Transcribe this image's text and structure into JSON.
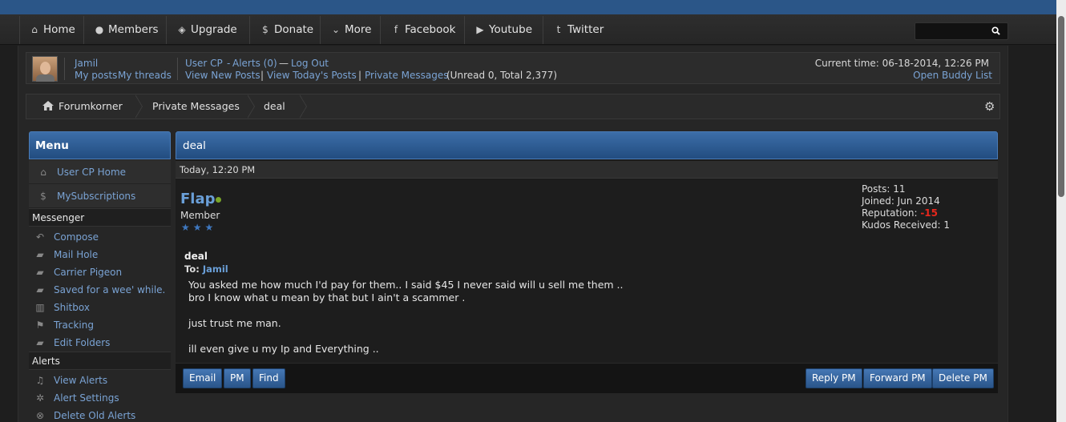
{
  "nav": {
    "items": [
      {
        "icon": "home-icon",
        "glyph": "⌂",
        "label": "Home"
      },
      {
        "icon": "members-icon",
        "glyph": "●",
        "label": "Members"
      },
      {
        "icon": "tag-icon",
        "glyph": "◈",
        "label": "Upgrade"
      },
      {
        "icon": "dollar-icon",
        "glyph": "$",
        "label": "Donate"
      },
      {
        "icon": "chevron-down-icon",
        "glyph": "⌄",
        "label": "More"
      },
      {
        "icon": "facebook-icon",
        "glyph": "f",
        "label": "Facebook"
      },
      {
        "icon": "play-icon",
        "glyph": "▶",
        "label": "Youtube"
      },
      {
        "icon": "twitter-icon",
        "glyph": "t",
        "label": "Twitter"
      }
    ],
    "search_placeholder": ""
  },
  "welcome": {
    "username": "Jamil",
    "my_posts": "My posts",
    "my_threads": "My threads",
    "user_cp": "User CP",
    "dash": "-",
    "alerts": "Alerts (0)",
    "emdash": "—",
    "log_out": "Log Out",
    "view_new_posts": "View New Posts",
    "pipe": "|",
    "view_todays_posts": "View Today's Posts",
    "private_messages": "Private Messages",
    "unread_total": "(Unread 0, Total 2,377)",
    "current_time": "Current time: 06-18-2014, 12:26 PM",
    "open_buddy_list": "Open Buddy List"
  },
  "breadcrumb": {
    "home": "Forumkorner",
    "section": "Private Messages",
    "current": "deal"
  },
  "sidebar": {
    "title": "Menu",
    "top_items": [
      {
        "icon": "home-icon",
        "glyph": "⌂",
        "label": "User CP Home"
      },
      {
        "icon": "dollar-icon",
        "glyph": "$",
        "label": "MySubscriptions"
      }
    ],
    "messenger_title": "Messenger",
    "messenger_items": [
      {
        "icon": "reply-icon",
        "glyph": "↶",
        "label": "Compose"
      },
      {
        "icon": "folder-open-icon",
        "glyph": "▰",
        "label": "Mail Hole"
      },
      {
        "icon": "folder-icon",
        "glyph": "▰",
        "label": "Carrier Pigeon"
      },
      {
        "icon": "folder-icon",
        "glyph": "▰",
        "label": "Saved for a wee' while."
      },
      {
        "icon": "trash-icon",
        "glyph": "▥",
        "label": "Shitbox"
      },
      {
        "icon": "flag-icon",
        "glyph": "⚑",
        "label": "Tracking"
      },
      {
        "icon": "folder-icon",
        "glyph": "▰",
        "label": "Edit Folders"
      }
    ],
    "alerts_title": "Alerts",
    "alerts_items": [
      {
        "icon": "bell-icon",
        "glyph": "♫",
        "label": "View Alerts"
      },
      {
        "icon": "cogs-icon",
        "glyph": "✲",
        "label": "Alert Settings"
      },
      {
        "icon": "delete-circle-icon",
        "glyph": "⊗",
        "label": "Delete Old Alerts"
      }
    ]
  },
  "message": {
    "header": "deal",
    "date": "Today, 12:20 PM",
    "author": "Flap",
    "author_title": "Member",
    "stars": "★★★",
    "posts": "Posts: 11",
    "joined": "Joined: Jun 2014",
    "reputation_label": "Reputation:",
    "reputation_value": "-15",
    "kudos": "Kudos Received: 1",
    "subject": "deal",
    "to_label": "To:",
    "to_user": "Jamil",
    "lines": [
      "You asked me how much I'd pay for them.. I said $45 I never said will u sell me them ..",
      "bro I know what u mean by that but I ain't a scammer .",
      "just trust me man.",
      "ill even give u my Ip and Everything .."
    ]
  },
  "buttons": {
    "email": "Email",
    "pm": "PM",
    "find": "Find",
    "reply_pm": "Reply PM",
    "forward_pm": "Forward PM",
    "delete_pm": "Delete PM"
  }
}
